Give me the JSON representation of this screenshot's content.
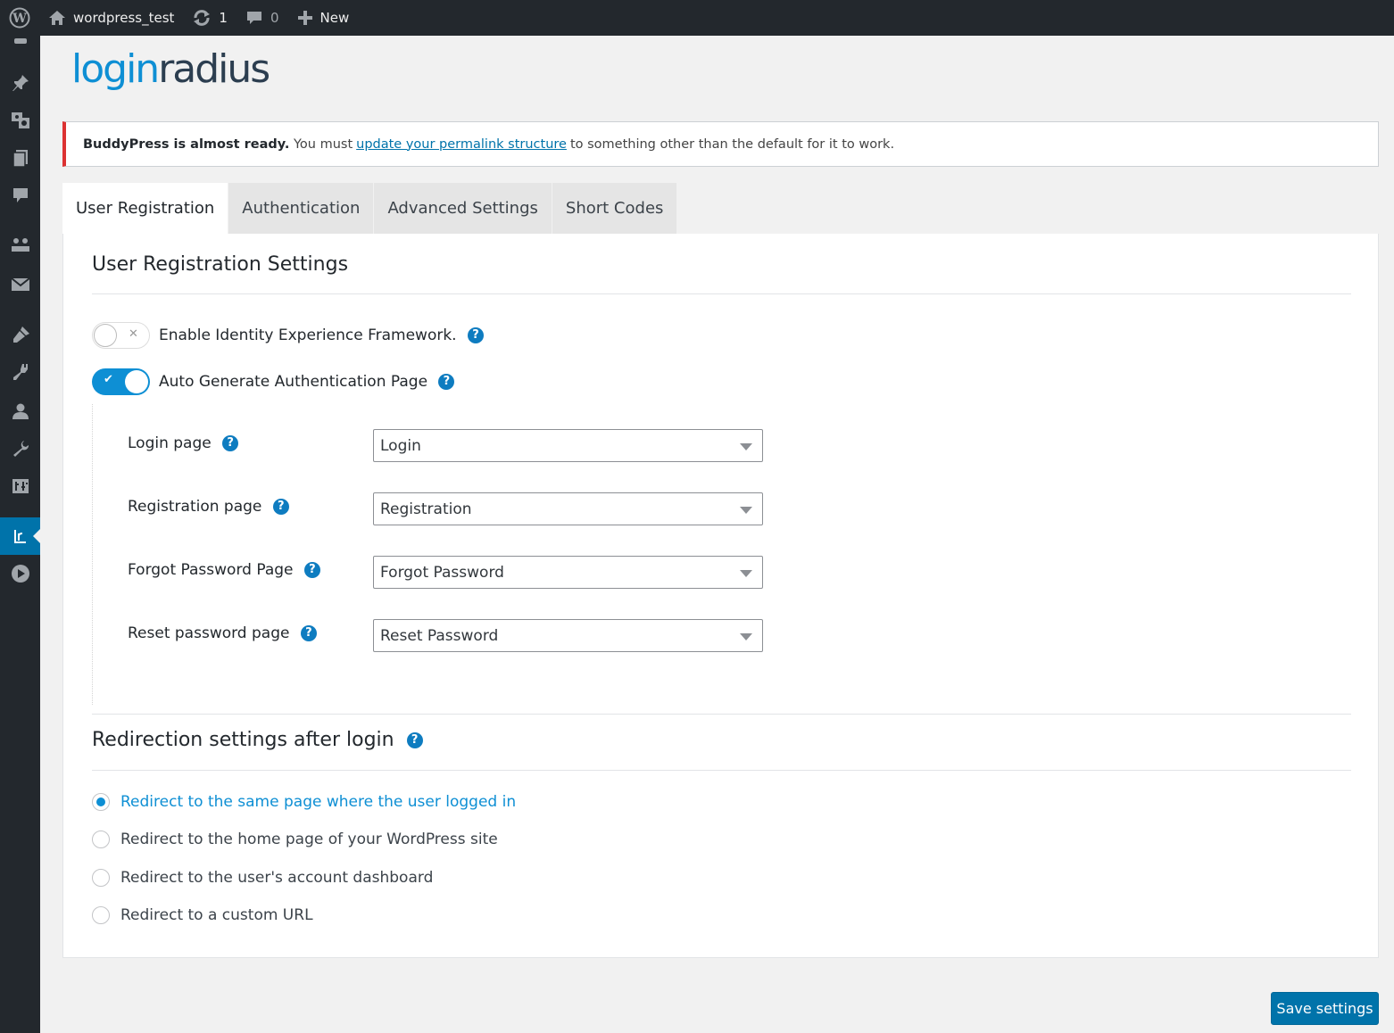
{
  "adminbar": {
    "site_name": "wordpress_test",
    "updates_count": "1",
    "comments_count": "0",
    "new_label": "New"
  },
  "sidebar": {
    "icons": [
      "pin-icon",
      "media-icon",
      "pages-icon",
      "comments-icon",
      "buddypress-icon",
      "mail-icon",
      "appearance-icon",
      "plugins-icon",
      "users-icon",
      "tools-icon",
      "settings-icon",
      "loginradius-icon",
      "media-player-icon"
    ]
  },
  "logo": {
    "part1": "login",
    "part2": "radius"
  },
  "notice": {
    "bold": "BuddyPress is almost ready.",
    "text_before": "You must",
    "link": "update your permalink structure",
    "text_after": "to something other than the default for it to work."
  },
  "tabs": [
    "User Registration",
    "Authentication",
    "Advanced Settings",
    "Short Codes"
  ],
  "section1": {
    "title": "User Registration Settings",
    "toggle1_label": "Enable Identity Experience Framework.",
    "toggle2_label": "Auto Generate Authentication Page",
    "fields": [
      {
        "label": "Login page",
        "value": "Login"
      },
      {
        "label": "Registration page",
        "value": "Registration"
      },
      {
        "label": "Forgot Password Page",
        "value": "Forgot Password"
      },
      {
        "label": "Reset password page",
        "value": "Reset Password"
      }
    ]
  },
  "section2": {
    "title": "Redirection settings after login",
    "options": [
      "Redirect to the same page where the user logged in",
      "Redirect to the home page of your WordPress site",
      "Redirect to the user's account dashboard",
      "Redirect to a custom URL"
    ]
  },
  "help_mark": "?",
  "save_label": "Save settings",
  "colors": {
    "accent": "#0e8fd4",
    "wp_blue": "#0073aa",
    "notice_red": "#dc3232",
    "dark": "#23282d"
  }
}
